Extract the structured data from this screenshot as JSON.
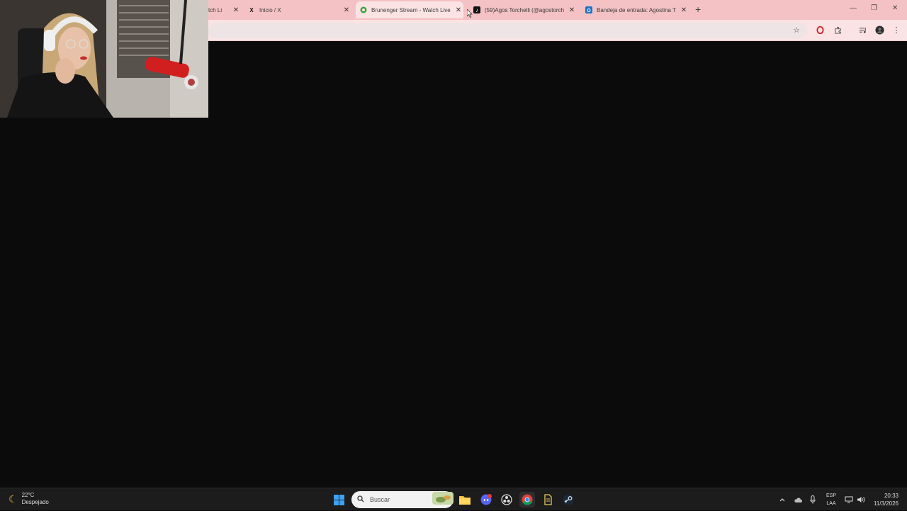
{
  "browser": {
    "tabs": [
      {
        "title": "tch Li",
        "favicon": "twitch-icon",
        "active": false
      },
      {
        "title": "Inicio / X",
        "favicon": "x-icon",
        "active": false
      },
      {
        "title": "Brunenger Stream - Watch Live",
        "favicon": "kick-icon",
        "active": true
      },
      {
        "title": "(59)Agos Torchelli (@agostorch",
        "favicon": "tiktok-icon",
        "active": false
      },
      {
        "title": "Bandeja de entrada: Agostina T",
        "favicon": "outlook-icon",
        "active": false
      }
    ],
    "new_tab_label": "+",
    "window_controls": {
      "minimize": "—",
      "maximize": "❐",
      "close": "✕"
    },
    "accent_color": "#f4c2c4"
  },
  "taskbar": {
    "weather": {
      "temperature": "22°C",
      "condition": "Despejado"
    },
    "search_placeholder": "Buscar",
    "language": {
      "line1": "ESP",
      "line2": "LAA"
    },
    "clock": {
      "time": "20:33",
      "date": "11/3/2026"
    },
    "apps": [
      "windows-start-icon",
      "file-explorer-icon",
      "discord-icon",
      "obs-icon",
      "chrome-icon",
      "notepad-icon",
      "steam-icon"
    ]
  }
}
